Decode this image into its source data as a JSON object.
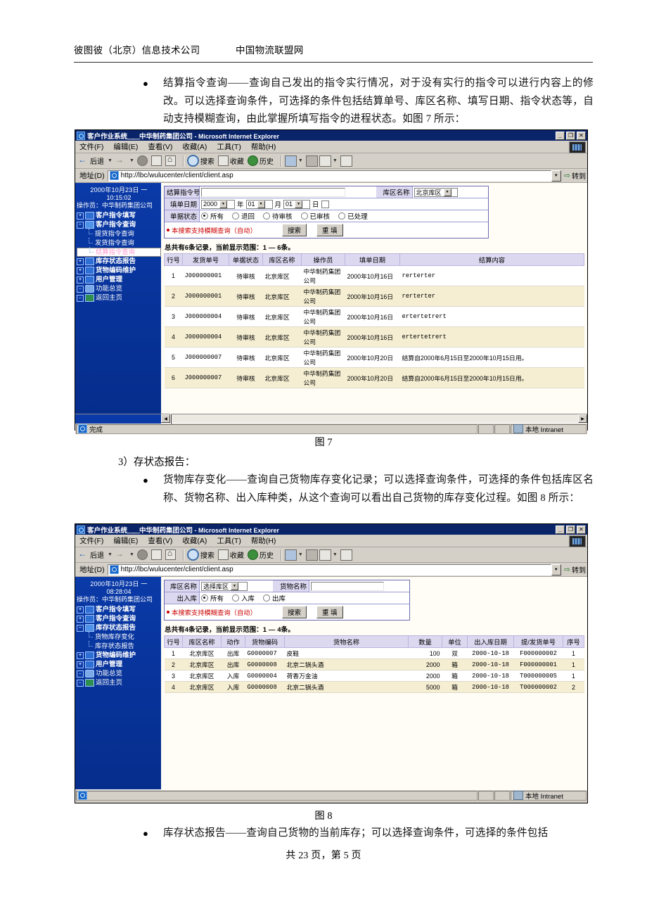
{
  "doc": {
    "header_left": "彼图彼（北京）信息技术公司",
    "header_right": "中国物流联盟网",
    "bullet_glyph": "●",
    "para1": "结算指令查询——查询自己发出的指令实行情况，对于没有实行的指令可以进行内容上的修改。可以选择查询条件，可选择的条件包括结算单号、库区名称、填写日期、指令状态等，自动支持模糊查询，由此掌握所填写指令的进程状态。如图 7 所示：",
    "fig7_caption": "图 7",
    "section3_number": "3）存状态报告：",
    "para2": "货物库存变化——查询自己货物库存变化记录；可以选择查询条件，可选择的条件包括库区名称、货物名称、出入库种类，从这个查询可以看出自己货物的库存变化过程。如图 8 所示：",
    "fig8_caption": "图 8",
    "para3": "库存状态报告——查询自己货物的当前库存；可以选择查询条件，可选择的条件包括",
    "footer": "共 23 页，第 5 页"
  },
  "browser": {
    "title_app": "客户作业系统",
    "title_sep": "＿＿",
    "title_company": "中华制药集团公司",
    "title_suffix": " - Microsoft Internet Explorer",
    "win_minimize": "_",
    "win_restore": "❐",
    "win_close": "✕",
    "menu": [
      {
        "label": "文件(F)"
      },
      {
        "label": "编辑(E)"
      },
      {
        "label": "查看(V)"
      },
      {
        "label": "收藏(A)"
      },
      {
        "label": "工具(T)"
      },
      {
        "label": "帮助(H)"
      }
    ],
    "toolbar": {
      "back": "后退",
      "forward": "",
      "search": "搜索",
      "favorites": "收藏",
      "history": "历史"
    },
    "address": {
      "label": "地址(D)",
      "url": "http://lbc/wulucenter/client/client.asp",
      "go": "转到"
    },
    "status": {
      "done": "完成",
      "blank": "",
      "zone": "本地 Intranet"
    }
  },
  "fig7": {
    "nav": {
      "date": "2000年10月23日 一",
      "time": "10:15:02",
      "operator": "操作员：中华制药集团公司",
      "tree": [
        {
          "label": "客户指令填写",
          "level": 0,
          "state": "collapsed",
          "icon": "folder-closed-icon",
          "selected": false
        },
        {
          "label": "客户指令查询",
          "level": 0,
          "state": "expanded",
          "icon": "folder-open-icon",
          "selected": false
        },
        {
          "label": "提货指令查询",
          "level": 1,
          "state": "leaf",
          "icon": "tree-branch-icon",
          "selected": false
        },
        {
          "label": "发货指令查询",
          "level": 1,
          "state": "leaf",
          "icon": "tree-branch-icon",
          "selected": false
        },
        {
          "label": "结算指令查询",
          "level": 1,
          "state": "leaf",
          "icon": "tree-branch-icon",
          "selected": true
        },
        {
          "label": "库存状态报告",
          "level": 0,
          "state": "collapsed",
          "icon": "folder-closed-icon",
          "selected": false
        },
        {
          "label": "货物编码维护",
          "level": 0,
          "state": "collapsed",
          "icon": "folder-closed-icon",
          "selected": false
        },
        {
          "label": "用户管理",
          "level": 0,
          "state": "collapsed",
          "icon": "folder-closed-icon",
          "selected": false
        },
        {
          "label": "功能总览",
          "level": 0,
          "state": "expanded",
          "icon": "globe-icon",
          "selected": false
        },
        {
          "label": "返回主页",
          "level": 0,
          "state": "expanded",
          "icon": "home-icon",
          "selected": false
        }
      ]
    },
    "form": {
      "label_order_no": "结算指令号",
      "value_order_no": "",
      "label_warehouse": "库区名称",
      "value_warehouse": "北京库区",
      "label_fill_date": "填单日期",
      "year_value": "2000",
      "year_unit": "年",
      "month_value": "01",
      "month_unit": "月",
      "day_value": "01",
      "day_unit": "日",
      "label_doc_status": "单据状态",
      "status_options": [
        "所有",
        "退回",
        "待审核",
        "已审核",
        "已处理"
      ],
      "status_selected": "所有",
      "hint": "本搜索支持模糊查询（自动）",
      "btn_search": "搜索",
      "btn_reset": "重 填"
    },
    "summary": "总共有6条记录，当前显示范围：1 — 6条。",
    "table": {
      "columns": [
        "行号",
        "发货单号",
        "单据状态",
        "库区名称",
        "操作员",
        "填单日期",
        "结算内容"
      ],
      "rows": [
        [
          "1",
          "J000000001",
          "待审核",
          "北京库区",
          "中华制药集团公司",
          "2000年10月16日",
          "rerterter"
        ],
        [
          "2",
          "J000000001",
          "待审核",
          "北京库区",
          "中华制药集团公司",
          "2000年10月16日",
          "rerterter"
        ],
        [
          "3",
          "J000000004",
          "待审核",
          "北京库区",
          "中华制药集团公司",
          "2000年10月16日",
          "ertertetrert"
        ],
        [
          "4",
          "J000000004",
          "待审核",
          "北京库区",
          "中华制药集团公司",
          "2000年10月16日",
          "ertertetrert"
        ],
        [
          "5",
          "J000000007",
          "待审核",
          "北京库区",
          "中华制药集团公司",
          "2000年10月20日",
          "结算自2000年6月15日至2000年10月15日用。"
        ],
        [
          "6",
          "J000000007",
          "待审核",
          "北京库区",
          "中华制药集团公司",
          "2000年10月20日",
          "结算自2000年6月15日至2000年10月15日用。"
        ]
      ]
    }
  },
  "fig8": {
    "nav": {
      "date": "2000年10月23日 一",
      "time": "08:28:04",
      "operator": "操作员：中华制药集团公司",
      "tree": [
        {
          "label": "客户指令填写",
          "level": 0,
          "state": "collapsed",
          "icon": "folder-closed-icon",
          "selected": false
        },
        {
          "label": "客户指令查询",
          "level": 0,
          "state": "collapsed",
          "icon": "folder-closed-icon",
          "selected": false
        },
        {
          "label": "库存状态报告",
          "level": 0,
          "state": "expanded",
          "icon": "folder-open-icon",
          "selected": false
        },
        {
          "label": "货物库存变化",
          "level": 1,
          "state": "leaf",
          "icon": "tree-branch-icon",
          "selected": false
        },
        {
          "label": "库存状态报告",
          "level": 1,
          "state": "leaf",
          "icon": "tree-branch-icon",
          "selected": false
        },
        {
          "label": "货物编码维护",
          "level": 0,
          "state": "collapsed",
          "icon": "folder-closed-icon",
          "selected": false
        },
        {
          "label": "用户管理",
          "level": 0,
          "state": "collapsed",
          "icon": "folder-closed-icon",
          "selected": false
        },
        {
          "label": "功能总览",
          "level": 0,
          "state": "expanded",
          "icon": "globe-icon",
          "selected": false
        },
        {
          "label": "返回主页",
          "level": 0,
          "state": "expanded",
          "icon": "home-icon",
          "selected": false
        }
      ]
    },
    "form": {
      "label_warehouse": "库区名称",
      "value_warehouse": "选择库区",
      "label_goods": "货物名称",
      "value_goods": "",
      "label_inout": "出入库",
      "inout_options": [
        "所有",
        "入库",
        "出库"
      ],
      "inout_selected": "所有",
      "hint": "本搜索支持模糊查询（自动）",
      "btn_search": "搜索",
      "btn_reset": "重 填"
    },
    "summary": "总共有4条记录，当前显示范围：1 — 4条。",
    "table": {
      "columns": [
        "行号",
        "库区名称",
        "动作",
        "货物编码",
        "货物名称",
        "数量",
        "单位",
        "出入库日期",
        "提/发货单号",
        "序号"
      ],
      "rows": [
        [
          "1",
          "北京库区",
          "出库",
          "G0000007",
          "皮鞋",
          "100",
          "双",
          "2000-10-18",
          "F000000002",
          "1"
        ],
        [
          "2",
          "北京库区",
          "出库",
          "G0000008",
          "北京二锅头酒",
          "2000",
          "箱",
          "2000-10-18",
          "F000000001",
          "1"
        ],
        [
          "3",
          "北京库区",
          "入库",
          "G0000004",
          "荷香万金油",
          "2000",
          "箱",
          "2000-10-18",
          "T000000005",
          "1"
        ],
        [
          "4",
          "北京库区",
          "入库",
          "G0000008",
          "北京二锅头酒",
          "5000",
          "箱",
          "2000-10-18",
          "T000000002",
          "2"
        ]
      ]
    }
  },
  "colors": {
    "titlebar": "#0a246a",
    "chrome": "#d4d0c8",
    "nav_bg": "#052d8c",
    "table_header": "#dcd8f0",
    "row_alt": "#f5eed2",
    "hint_red": "#cc0000",
    "selected_node": "#ff9bd0"
  }
}
